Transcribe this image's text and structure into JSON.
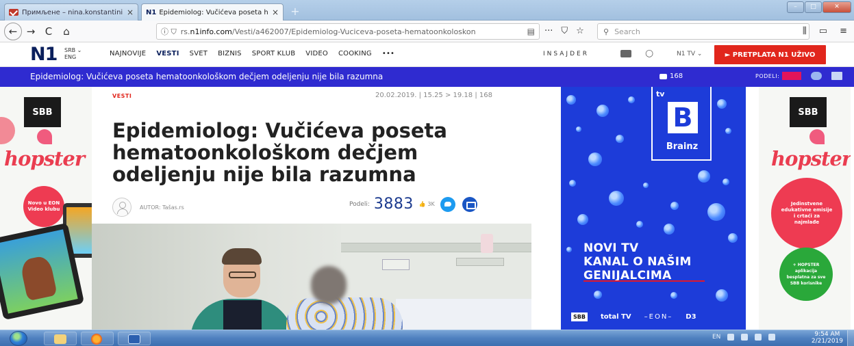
{
  "browser": {
    "tabs": [
      {
        "title": "Примљене – nina.konstantini",
        "close": "×"
      },
      {
        "favicon_text": "N1",
        "title": "Epidemiolog: Vučićeva poseta h",
        "close": "×"
      }
    ],
    "new_tab": "+",
    "url": {
      "prefix": "rs.",
      "host": "n1info.com",
      "path": "/Vesti/a462007/Epidemiolog-Vuciceva-poseta-hematoonkoloskon"
    },
    "search_placeholder": "Search",
    "page_actions": {
      "more": "···",
      "pocket": "⛉",
      "bookmark": "☆"
    }
  },
  "site": {
    "logo": "N1",
    "region": {
      "top": "SRB ⌄",
      "bottom": "ENG"
    },
    "nav": [
      "NAJNOVIJE",
      "VESTI",
      "SVET",
      "BIZNIS",
      "SPORT KLUB",
      "VIDEO",
      "COOKING",
      "•••"
    ],
    "active_nav": "VESTI",
    "insajder": "INSAJDER",
    "n1tv": "N1 TV ⌄",
    "cta": "► PRETPLATA N1 UŽIVO"
  },
  "sticky": {
    "title": "Epidemiolog: Vučićeva poseta hematoonkološkom dečjem odeljenju nije bila razumna",
    "comments": "168",
    "share_label": "PODELI:"
  },
  "article": {
    "section": "VESTI",
    "meta": "20.02.2019. | 15.25 > 19.18 | 168",
    "headline_lines": [
      "Epidemiolog: Vučićeva poseta",
      "hematoonkološkom dečjem",
      "odeljenju nije bila razumna"
    ],
    "author": "AUTOR: Tašas.rs",
    "share_label": "Podeli:",
    "share_count": "3883",
    "likes": "3K"
  },
  "ads": {
    "left": {
      "brand": "SBB",
      "product": "hopster",
      "promo": "Novo u EON Video klubu"
    },
    "right": {
      "brand": "SBB",
      "product": "hopster",
      "promo": "Jedinstvene edukativne emisije i crtaći za najmlađe",
      "promo2": "+ HOPSTER aplikacija besplatna za sve SBB korisnike"
    },
    "tv": {
      "channel_prefix": "tv",
      "channel_letter": "B",
      "channel_name": "Brainz",
      "slogan_lines": [
        "NOVI TV",
        "KANAL O NAŠIM",
        "GENIJALCIMA"
      ],
      "footer_logos": [
        "SBB",
        "total TV",
        "–EON–",
        "D3"
      ]
    }
  },
  "taskbar": {
    "tray_lang": "EN",
    "time": "9:54 AM",
    "date": "2/21/2019"
  },
  "colors": {
    "brand_navy": "#0a1f5c",
    "sticky_bar": "#2f2bd0",
    "cta_red": "#e1261c",
    "tv_ad_blue": "#1d3cd9",
    "share_count": "#1c3b8f"
  }
}
